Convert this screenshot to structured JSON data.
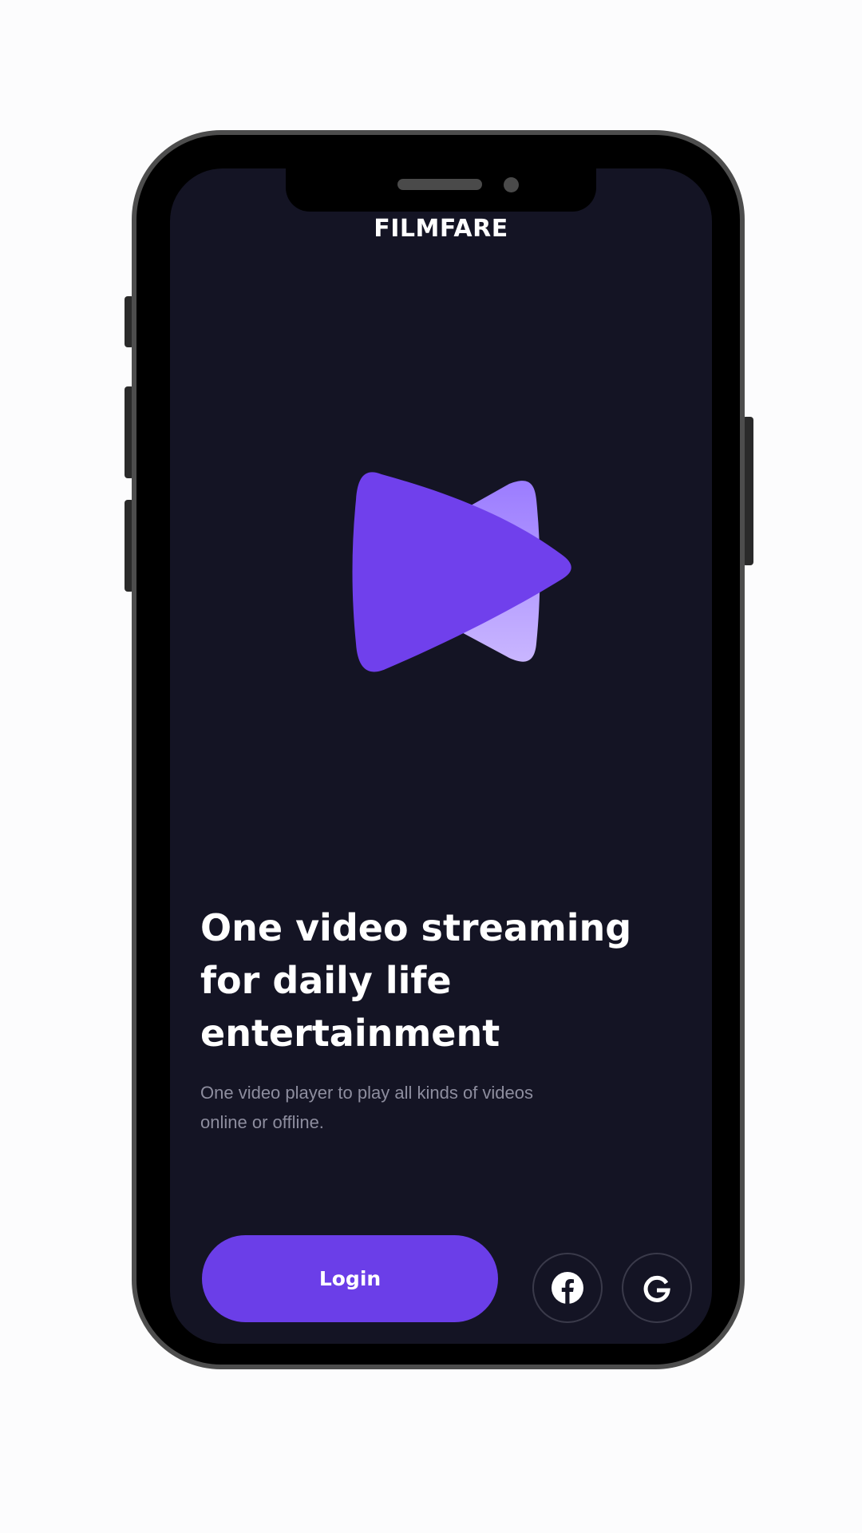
{
  "app": {
    "brand": "FILMFARE"
  },
  "hero": {
    "headline": "One video streaming for  daily life entertainment",
    "subline": "One video player to play all kinds of videos online or offline."
  },
  "actions": {
    "login_label": "Login",
    "social": [
      {
        "name": "facebook",
        "icon": "facebook-icon"
      },
      {
        "name": "google",
        "icon": "google-icon"
      }
    ]
  },
  "colors": {
    "screen_background": "#141424",
    "accent": "#6b3ee8",
    "logo_back_shape": "#a58cff",
    "logo_front_shape": "#7040ec",
    "text_primary": "#ffffff",
    "text_secondary": "#8d8d9e"
  }
}
